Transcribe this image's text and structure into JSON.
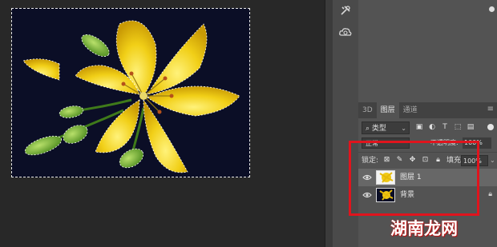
{
  "panel": {
    "tabs": [
      {
        "label": "3D",
        "active": false
      },
      {
        "label": "图层",
        "active": true
      },
      {
        "label": "通道",
        "active": false
      }
    ],
    "filter": {
      "selected": "类型",
      "icons": [
        "image-filter-icon",
        "adjustment-filter-icon",
        "type-filter-icon",
        "shape-filter-icon",
        "smart-object-filter-icon"
      ]
    },
    "blend": {
      "mode": "正常",
      "opacity_label": "不透明度:",
      "opacity_value": "100%"
    },
    "lock": {
      "label": "锁定:",
      "fill_label": "填充:",
      "fill_value": "100%"
    },
    "layers": [
      {
        "name": "图层 1",
        "selected": true
      },
      {
        "name": "背景",
        "selected": false,
        "locked": true
      }
    ]
  },
  "strip": {
    "icons": [
      "tools-icon",
      "libraries-icon"
    ]
  },
  "colors": {
    "highlight_box": "#e0141d",
    "canvas_bg": "#0b0e26",
    "flower": "#f2d21a"
  },
  "watermark": "湖南龙网"
}
